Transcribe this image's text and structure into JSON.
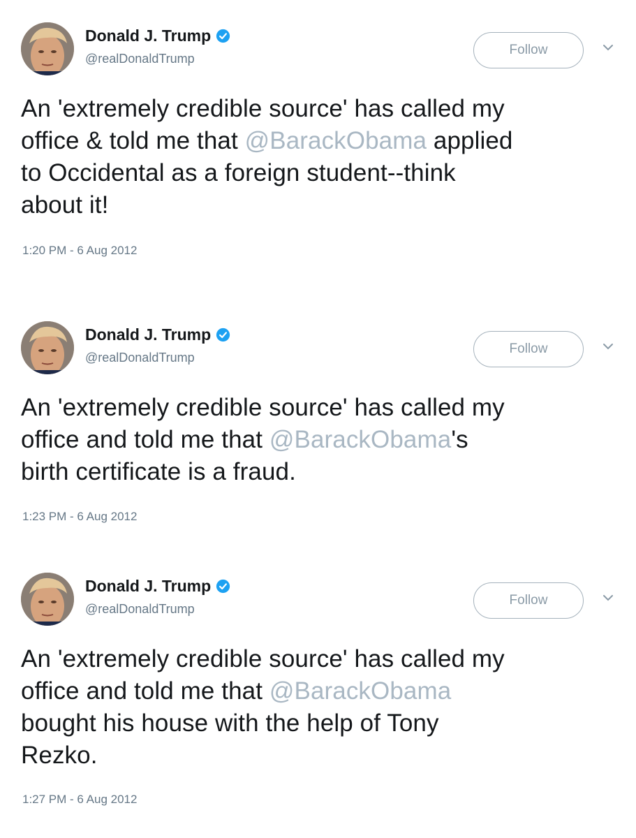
{
  "colors": {
    "text": "#14171a",
    "handle": "#657786",
    "mention": "#a9b7c3",
    "verified": "#1da1f2",
    "follow_border": "#a4b1bb"
  },
  "tweets": [
    {
      "name": "Donald J. Trump",
      "handle": "@realDonaldTrump",
      "follow_label": "Follow",
      "lines": [
        {
          "before": "An 'extremely credible source' has called my",
          "mention": "",
          "after": ""
        },
        {
          "before": "office & told me that ",
          "mention": "@BarackObama",
          "after": " applied"
        },
        {
          "before": "to Occidental as a foreign student--think",
          "mention": "",
          "after": ""
        },
        {
          "before": "about it!",
          "mention": "",
          "after": ""
        }
      ],
      "timestamp": "1:20 PM - 6 Aug 2012"
    },
    {
      "name": "Donald J. Trump",
      "handle": "@realDonaldTrump",
      "follow_label": "Follow",
      "lines": [
        {
          "before": "An 'extremely credible source' has called my",
          "mention": "",
          "after": ""
        },
        {
          "before": "office and told me that ",
          "mention": "@BarackObama",
          "after": "'s"
        },
        {
          "before": "birth certificate is a fraud.",
          "mention": "",
          "after": ""
        }
      ],
      "timestamp": "1:23 PM - 6 Aug 2012"
    },
    {
      "name": "Donald J. Trump",
      "handle": "@realDonaldTrump",
      "follow_label": "Follow",
      "lines": [
        {
          "before": "An 'extremely credible source' has called my",
          "mention": "",
          "after": ""
        },
        {
          "before": "office and told me that ",
          "mention": "@BarackObama",
          "after": ""
        },
        {
          "before": "bought his house with the help of Tony",
          "mention": "",
          "after": ""
        },
        {
          "before": "Rezko.",
          "mention": "",
          "after": ""
        }
      ],
      "timestamp": "1:27 PM - 6 Aug 2012"
    }
  ],
  "icons": {
    "verified": "verified-badge-icon",
    "chevron": "chevron-down-icon",
    "avatar": "profile-photo"
  }
}
